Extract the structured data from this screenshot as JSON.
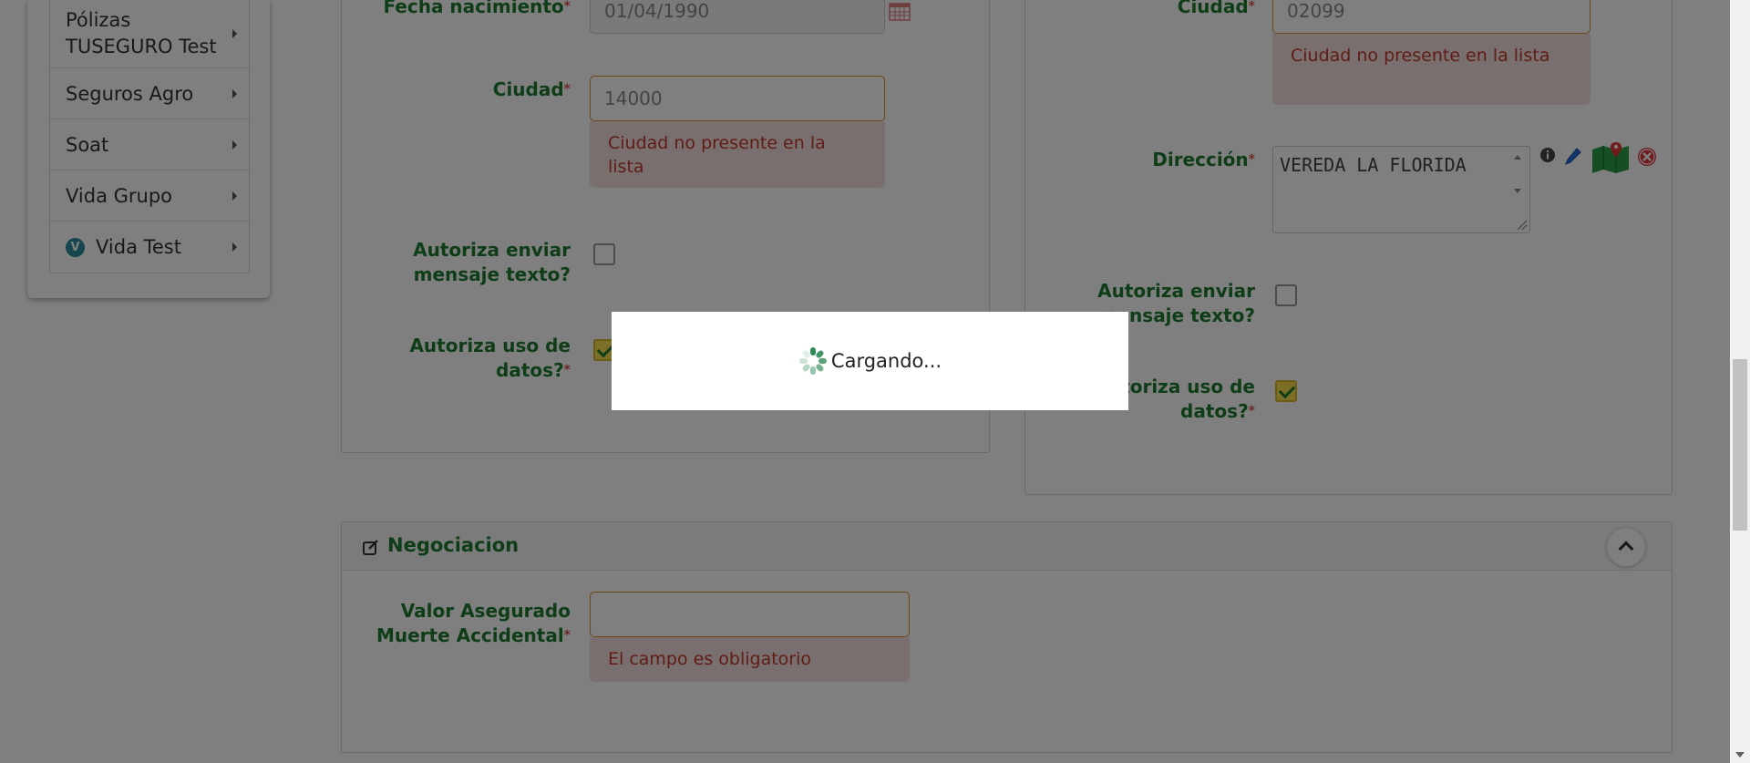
{
  "sidebar": {
    "items": [
      {
        "label": "Pólizas TUSEGURO Test"
      },
      {
        "label": "Seguros Agro"
      },
      {
        "label": "Soat"
      },
      {
        "label": "Vida Grupo"
      },
      {
        "label": "Vida Test",
        "badge": "V"
      }
    ]
  },
  "left_form": {
    "birth_label": "Fecha nacimiento",
    "birth_value": "01/04/1990",
    "city_label": "Ciudad",
    "city_value": "14000",
    "city_error": "Ciudad no presente en la lista",
    "sms_label": "Autoriza enviar mensaje texto?",
    "sms_checked": false,
    "data_label": "Autoriza uso de datos?",
    "data_checked": true
  },
  "right_form": {
    "city_label": "Ciudad",
    "city_value": "02099",
    "city_error": "Ciudad no presente en la lista",
    "address_label": "Dirección",
    "address_value": "VEREDA LA FLORIDA",
    "sms_label": "Autoriza enviar mensaje texto?",
    "sms_checked": false,
    "data_label": "Autoriza uso de datos?",
    "data_checked": true
  },
  "negociacion": {
    "title": "Negociacion",
    "value_label": "Valor Asegurado Muerte Accidental",
    "value": "",
    "value_error": "El campo es obligatorio"
  },
  "loading": {
    "text": "Cargando..."
  },
  "required_mark": "*",
  "colors": {
    "label_green": "#1e7a2f",
    "error_red": "#c0392b",
    "error_bg": "#f2dede",
    "invalid_border": "#e08a2d",
    "check_yellow": "#f6dc4c",
    "overlay": "rgba(0,0,0,0.5)"
  }
}
